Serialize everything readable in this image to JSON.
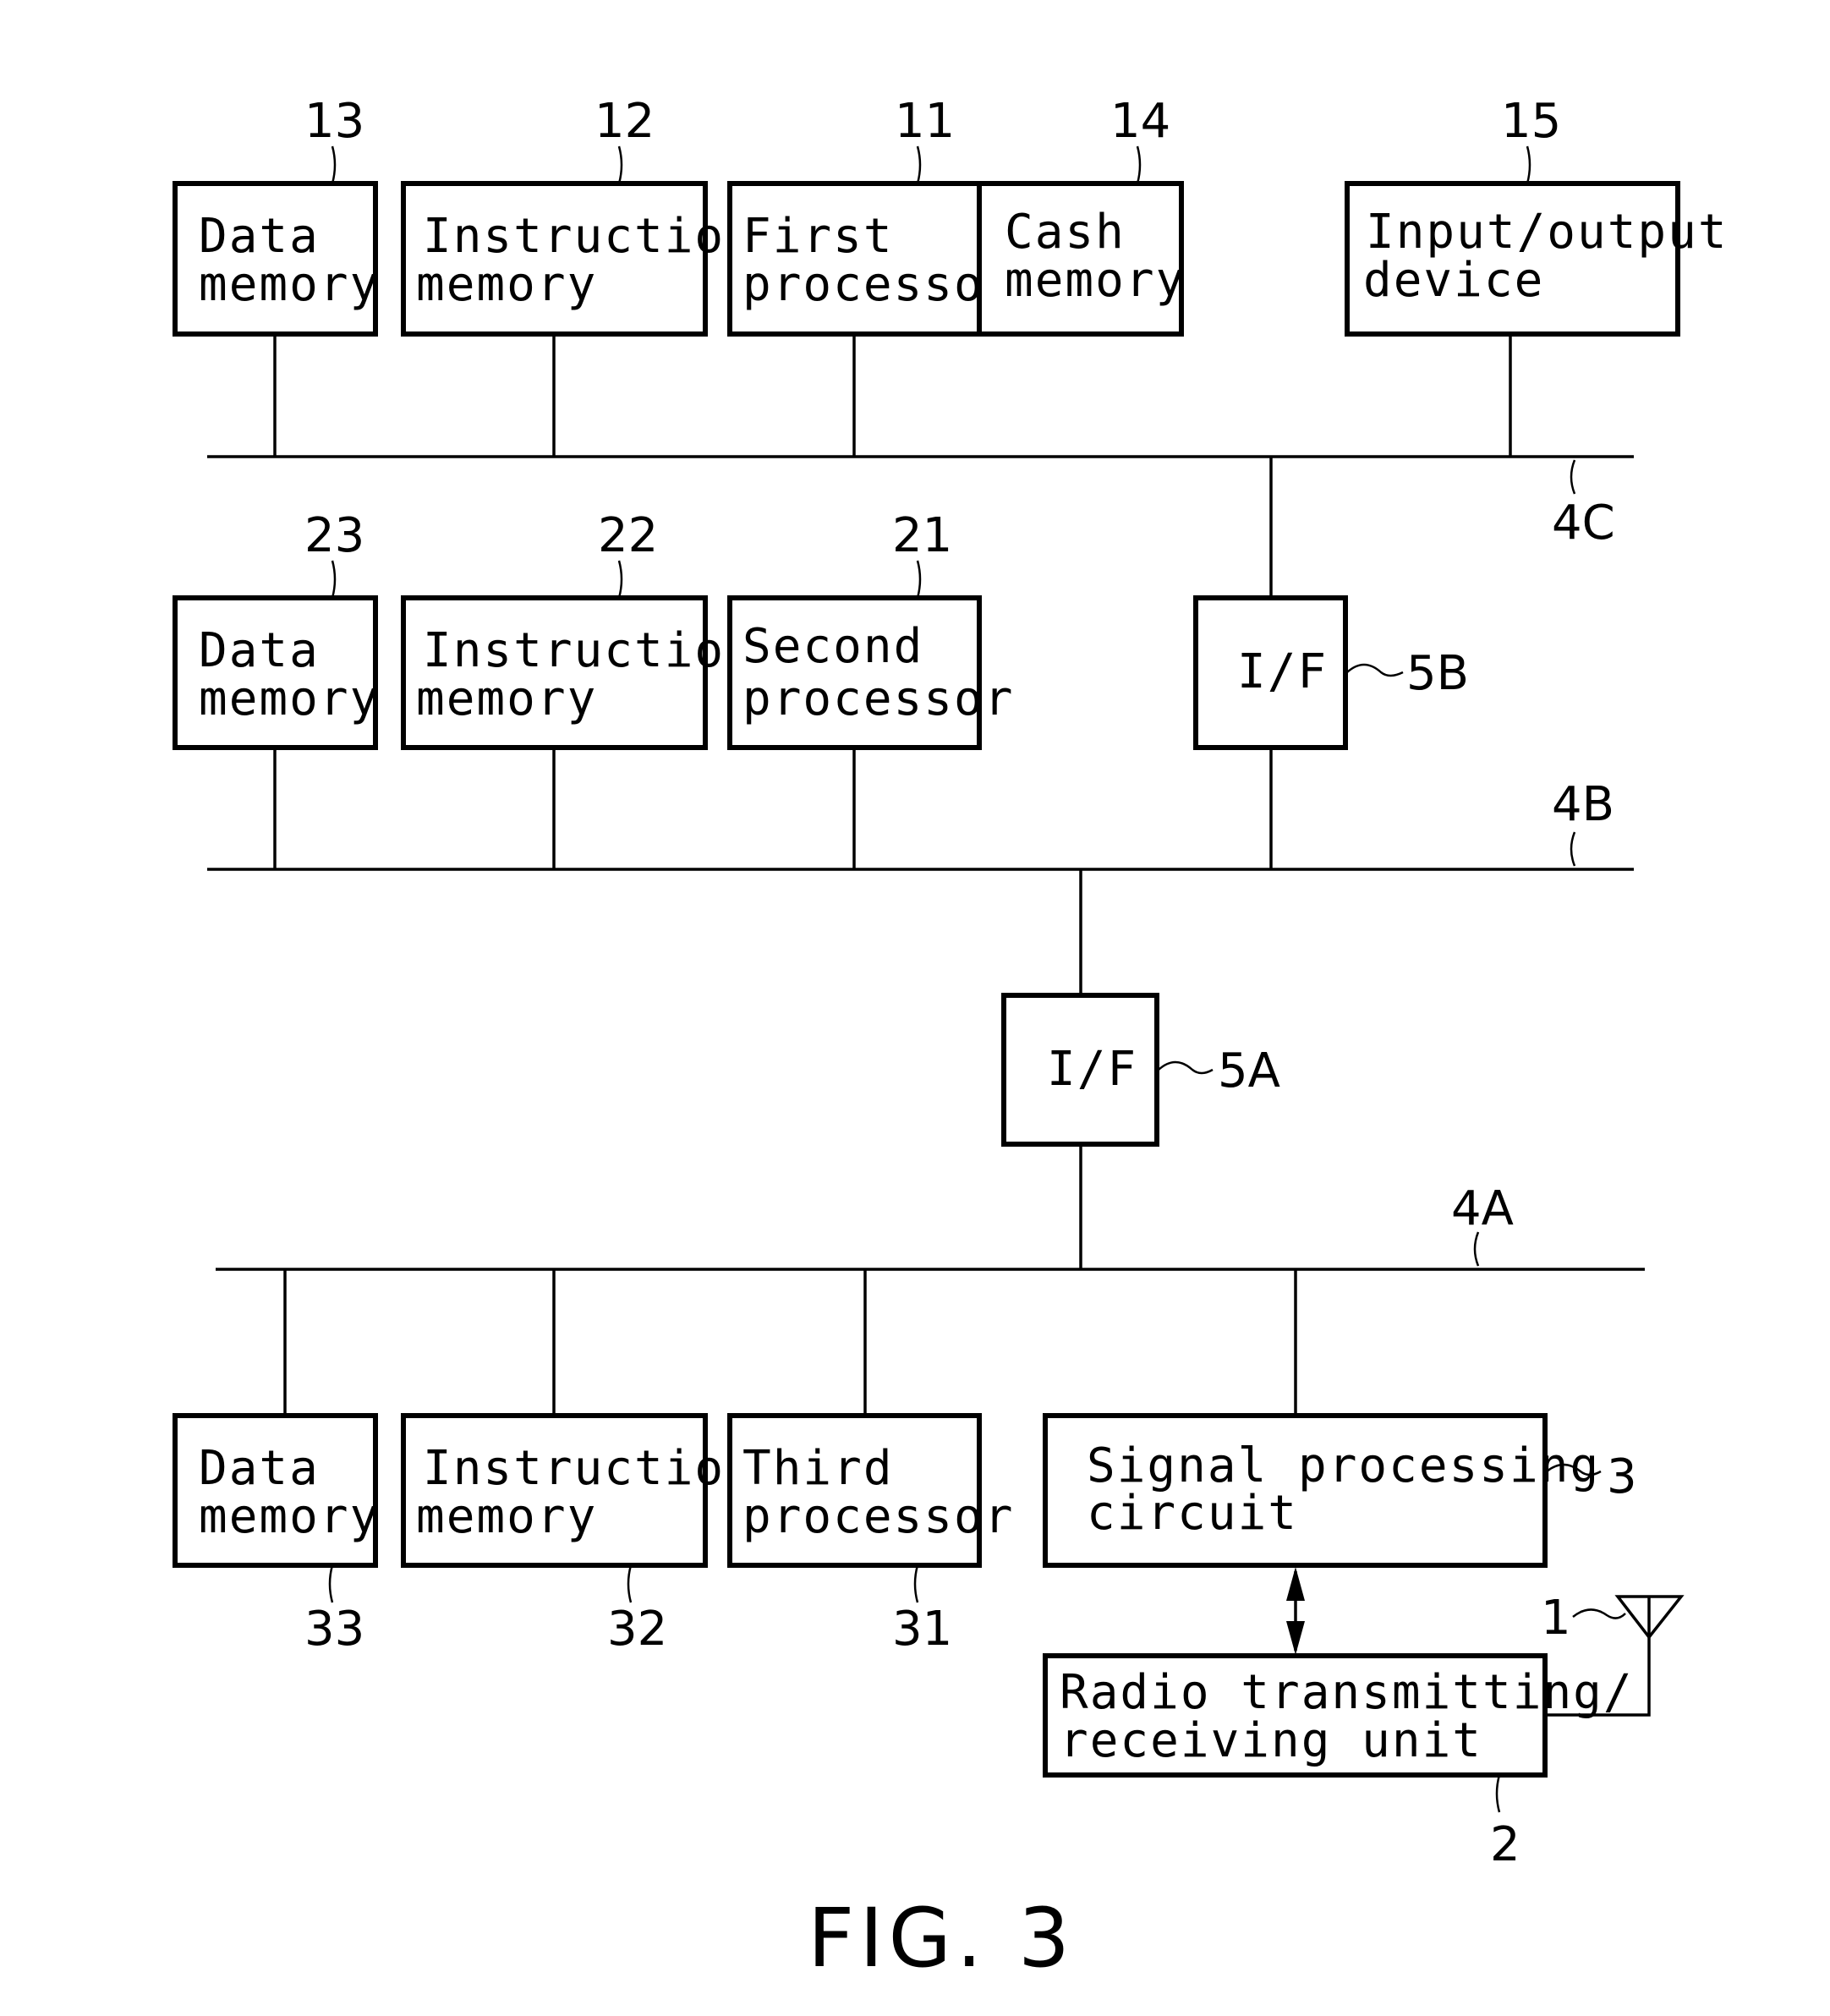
{
  "figure": {
    "caption": "FIG. 3",
    "blocks": {
      "data_memory_13": {
        "line1": "Data",
        "line2": "memory",
        "ref": "13"
      },
      "instruction_memory_12": {
        "line1": "Instruction",
        "line2": "memory",
        "ref": "12"
      },
      "first_processor_11": {
        "line1": "First",
        "line2": "processor",
        "ref": "11"
      },
      "cash_memory_14": {
        "line1": "Cash",
        "line2": "memory",
        "ref": "14"
      },
      "io_device_15": {
        "line1": "Input/output",
        "line2": "device",
        "ref": "15"
      },
      "data_memory_23": {
        "line1": "Data",
        "line2": "memory",
        "ref": "23"
      },
      "instruction_memory_22": {
        "line1": "Instruction",
        "line2": "memory",
        "ref": "22"
      },
      "second_processor_21": {
        "line1": "Second",
        "line2": "processor",
        "ref": "21"
      },
      "interface_5b": {
        "line1": "I/F",
        "ref": "5B"
      },
      "interface_5a": {
        "line1": "I/F",
        "ref": "5A"
      },
      "data_memory_33": {
        "line1": "Data",
        "line2": "memory",
        "ref": "33"
      },
      "instruction_memory_32": {
        "line1": "Instruction",
        "line2": "memory",
        "ref": "32"
      },
      "third_processor_31": {
        "line1": "Third",
        "line2": "processor",
        "ref": "31"
      },
      "signal_processing_3": {
        "line1": "Signal processing",
        "line2": "circuit",
        "ref": "3"
      },
      "radio_unit_2": {
        "line1": "Radio transmitting/",
        "line2": "receiving unit",
        "ref": "2"
      },
      "antenna_1": {
        "ref": "1"
      }
    },
    "buses": {
      "bus_4c": {
        "ref": "4C"
      },
      "bus_4b": {
        "ref": "4B"
      },
      "bus_4a": {
        "ref": "4A"
      }
    }
  }
}
